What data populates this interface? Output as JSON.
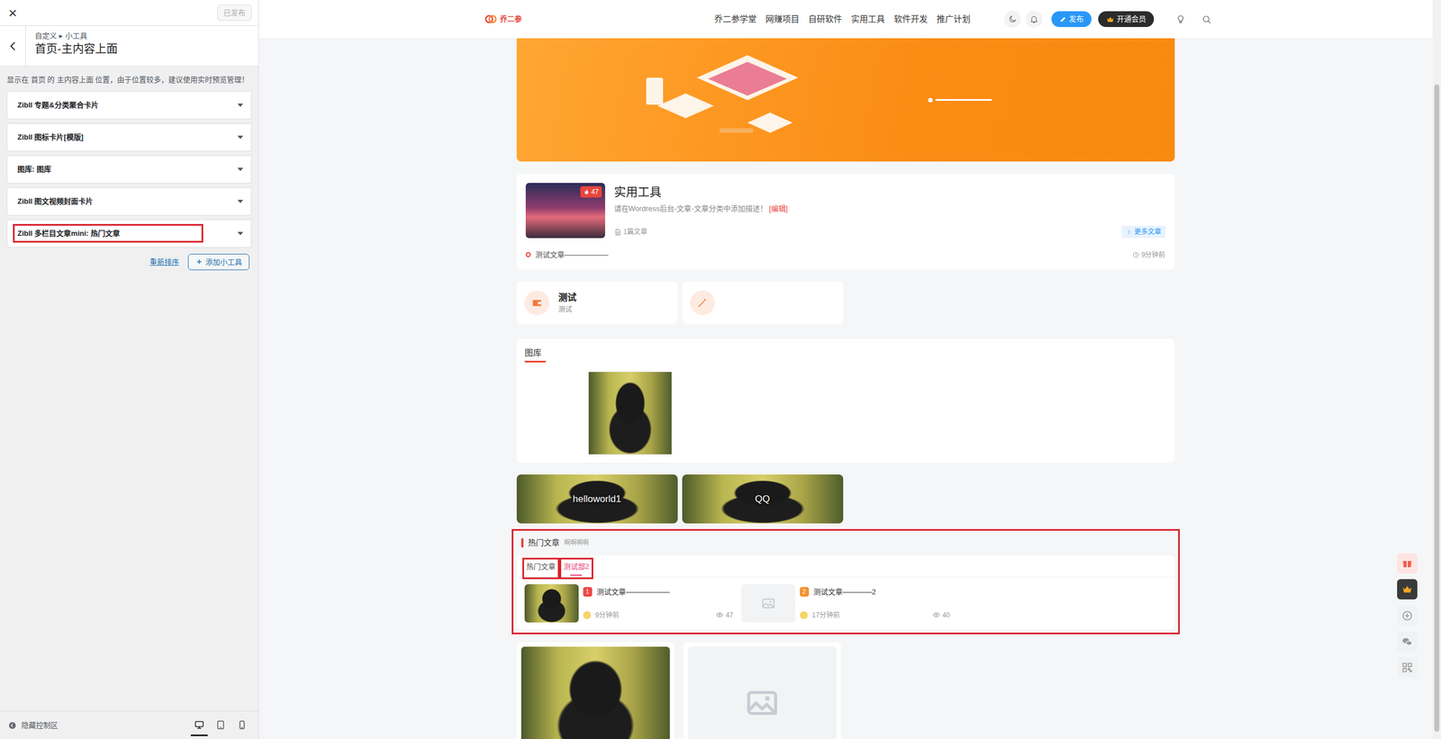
{
  "customizer": {
    "close": "×",
    "publish": {
      "label": "已发布",
      "disabled": true
    },
    "breadcrumb": {
      "parent": "自定义",
      "separator": "▸",
      "current": "小工具"
    },
    "title": "首页-主内容上面",
    "description": "显示在 首页 的 主内容上面 位置，由于位置较多，建议使用实时预览管理！",
    "widgets": [
      {
        "title": "Zibll 专题&分类聚合卡片",
        "highlighted": false
      },
      {
        "title": "Zibll 图标卡片[模版]",
        "highlighted": false
      },
      {
        "title": "图库: 图库",
        "highlighted": false
      },
      {
        "title": "Zibll 图文视频封面卡片",
        "highlighted": false
      },
      {
        "title": "Zibll 多栏目文章mini: 热门文章",
        "highlighted": true
      }
    ],
    "reorder": "重新排序",
    "add_widget": "添加小工具",
    "hide_controls": "隐藏控制区",
    "devices": [
      {
        "kind": "desktop",
        "selected": true
      },
      {
        "kind": "tablet",
        "selected": false
      },
      {
        "kind": "mobile",
        "selected": false
      }
    ]
  },
  "site": {
    "logo": "乔二参",
    "nav": [
      "乔二参学堂",
      "网赚项目",
      "自研软件",
      "实用工具",
      "软件开发",
      "推广计划"
    ],
    "publish": "发布",
    "vip": "开通会员",
    "category_card": {
      "title": "实用工具",
      "heat": "47",
      "description": "请在Wordress后台-文章-文章分类中添加描述！",
      "edit": "[编辑]",
      "count": "1篇文章",
      "more": "更多文章",
      "post": {
        "title": "测试文章——————",
        "time": "9分钟前"
      }
    },
    "icon_cards": [
      {
        "kind": "text",
        "title": "测试",
        "subtitle": "测试"
      },
      {
        "kind": "icon"
      }
    ],
    "gallery": {
      "title": "图库"
    },
    "image_cards": [
      {
        "title": "helloworld1"
      },
      {
        "title": "QQ"
      }
    ],
    "hot": {
      "title": "热门文章",
      "subtitle": "啊啊啊啊",
      "highlighted": true,
      "tabs": [
        {
          "label": "热门文章",
          "selected": false,
          "highlighted": true
        },
        {
          "label": "测试部2",
          "selected": true,
          "highlighted": true
        }
      ],
      "posts": [
        {
          "kind": "image",
          "rank": "1",
          "color": "#f04848",
          "title": "测试文章——————",
          "time": "9分钟前",
          "views": "47"
        },
        {
          "kind": "placeholder",
          "rank": "2",
          "color": "#f5912e",
          "title": "测试文章————2",
          "time": "17分钟前",
          "views": "40"
        }
      ]
    },
    "post_cards": [
      {
        "kind": "image"
      },
      {
        "kind": "placeholder"
      }
    ]
  }
}
